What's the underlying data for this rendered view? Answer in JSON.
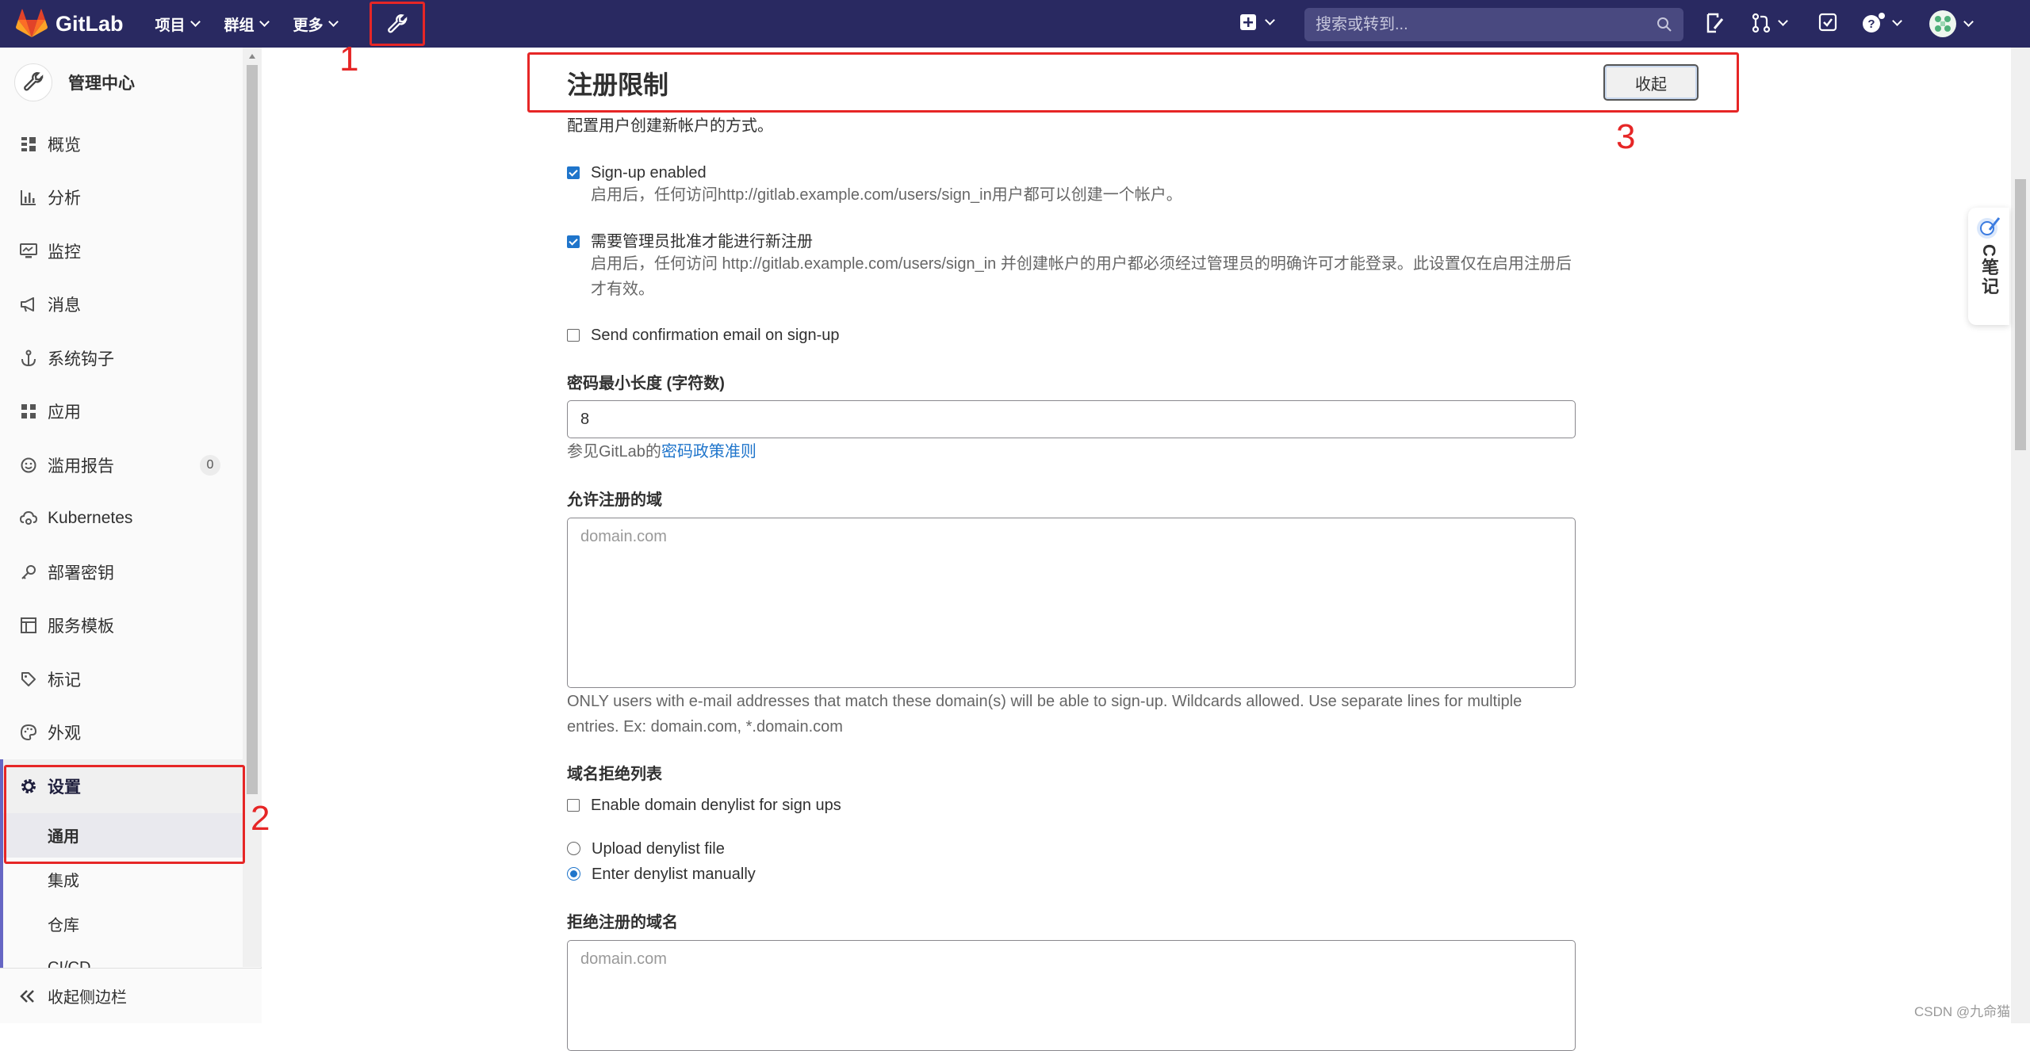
{
  "navbar": {
    "brand": "GitLab",
    "menu": [
      {
        "label": "项目"
      },
      {
        "label": "群组"
      },
      {
        "label": "更多"
      }
    ],
    "search_placeholder": "搜索或转到..."
  },
  "sidebar": {
    "title": "管理中心",
    "items": [
      {
        "label": "概览",
        "icon": "overview-icon"
      },
      {
        "label": "分析",
        "icon": "chart-icon"
      },
      {
        "label": "监控",
        "icon": "monitor-icon"
      },
      {
        "label": "消息",
        "icon": "megaphone-icon"
      },
      {
        "label": "系统钩子",
        "icon": "anchor-icon"
      },
      {
        "label": "应用",
        "icon": "apps-icon"
      },
      {
        "label": "滥用报告",
        "icon": "smiley-icon",
        "badge": "0"
      },
      {
        "label": "Kubernetes",
        "icon": "cloud-gear-icon"
      },
      {
        "label": "部署密钥",
        "icon": "key-icon"
      },
      {
        "label": "服务模板",
        "icon": "template-icon"
      },
      {
        "label": "标记",
        "icon": "tag-icon"
      },
      {
        "label": "外观",
        "icon": "palette-icon"
      }
    ],
    "active_item": {
      "label": "设置",
      "icon": "gear-icon"
    },
    "sub_items": [
      {
        "label": "通用",
        "active": true
      },
      {
        "label": "集成"
      },
      {
        "label": "仓库"
      },
      {
        "label": "CI/CD"
      }
    ],
    "collapse_label": "收起侧边栏"
  },
  "main": {
    "section_title": "注册限制",
    "collapse_button": "收起",
    "description": "配置用户创建新帐户的方式。",
    "signup_enabled": {
      "label": "Sign-up enabled",
      "checked": true,
      "help": "启用后，任何访问http://gitlab.example.com/users/sign_in用户都可以创建一个帐户。"
    },
    "admin_approval": {
      "label": "需要管理员批准才能进行新注册",
      "checked": true,
      "help": "启用后，任何访问 http://gitlab.example.com/users/sign_in 并创建帐户的用户都必须经过管理员的明确许可才能登录。此设置仅在启用注册后才有效。"
    },
    "send_confirmation": {
      "label": "Send confirmation email on sign-up",
      "checked": false
    },
    "min_password": {
      "label": "密码最小长度 (字符数)",
      "value": "8",
      "help_prefix": "参见GitLab的",
      "help_link": "密码政策准则"
    },
    "allowed_domains": {
      "label": "允许注册的域",
      "placeholder": "domain.com",
      "help": "ONLY users with e-mail addresses that match these domain(s) will be able to sign-up. Wildcards allowed. Use separate lines for multiple entries. Ex: domain.com, *.domain.com"
    },
    "denylist": {
      "label": "域名拒绝列表",
      "enable_label": "Enable domain denylist for sign ups",
      "enable_checked": false,
      "upload_label": "Upload denylist file",
      "manual_label": "Enter denylist manually",
      "selected": "manual"
    },
    "denied_domains": {
      "label": "拒绝注册的域名",
      "placeholder": "domain.com"
    }
  },
  "annotations": {
    "one": "1",
    "two": "2",
    "three": "3"
  },
  "note_widget": {
    "text": "C笔记"
  },
  "watermark": "CSDN @九命猫",
  "colors": {
    "navbar": "#292961",
    "accent": "#6666c4",
    "link": "#1f75cb",
    "highlight": "#e62626"
  }
}
